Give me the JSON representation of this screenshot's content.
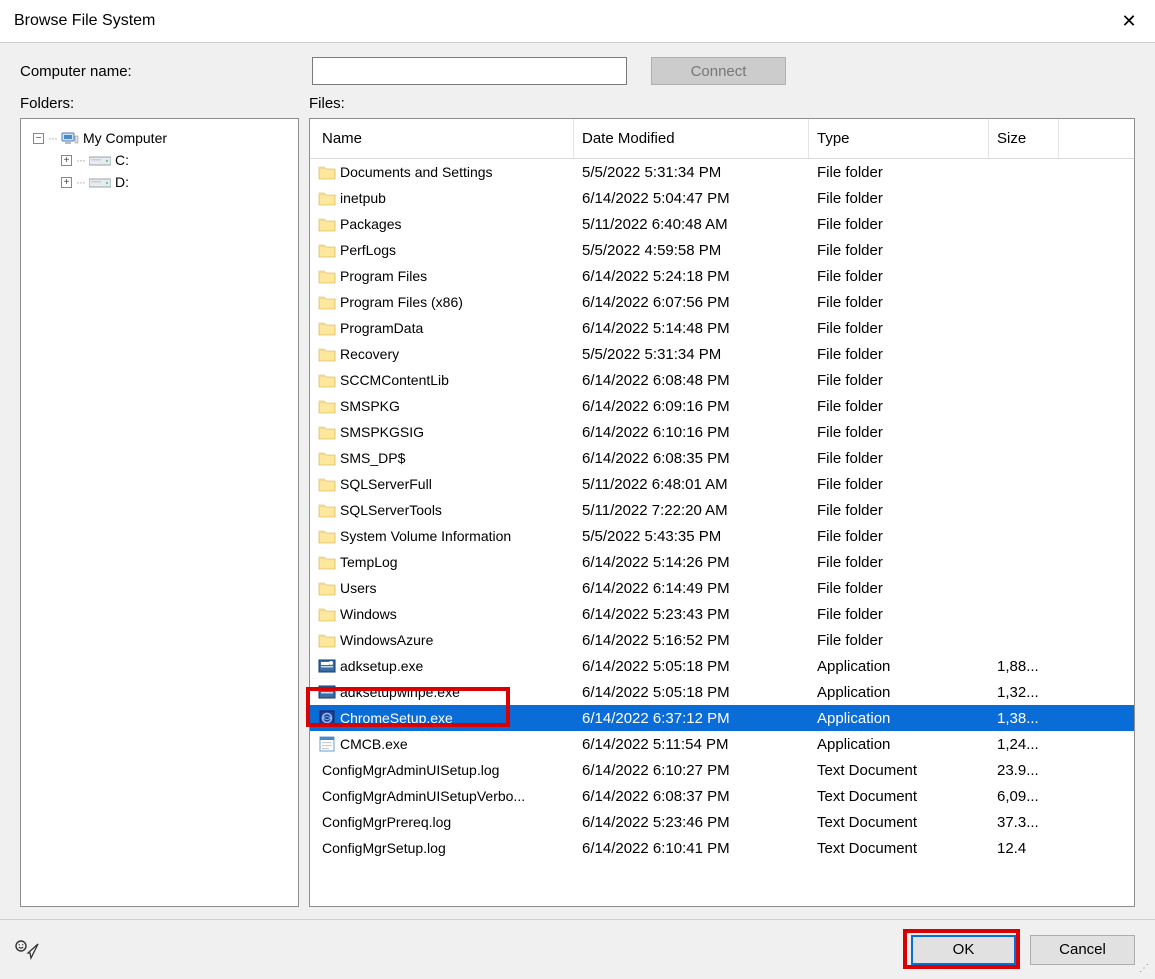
{
  "window": {
    "title": "Browse File System",
    "close_label": "✕"
  },
  "top": {
    "computer_name_label": "Computer name:",
    "computer_name_value": "",
    "connect_label": "Connect"
  },
  "pane_labels": {
    "folders": "Folders:",
    "files": "Files:"
  },
  "tree": {
    "root": {
      "label": "My Computer",
      "expanded": true
    },
    "drives": [
      {
        "label": "C:",
        "expanded": false
      },
      {
        "label": "D:",
        "expanded": false
      }
    ]
  },
  "columns": {
    "name": "Name",
    "date": "Date Modified",
    "type": "Type",
    "size": "Size"
  },
  "files": [
    {
      "name": "Documents and Settings",
      "date": "5/5/2022 5:31:34 PM",
      "type": "File folder",
      "size": "",
      "icon": "folder"
    },
    {
      "name": "inetpub",
      "date": "6/14/2022 5:04:47 PM",
      "type": "File folder",
      "size": "",
      "icon": "folder"
    },
    {
      "name": "Packages",
      "date": "5/11/2022 6:40:48 AM",
      "type": "File folder",
      "size": "",
      "icon": "folder"
    },
    {
      "name": "PerfLogs",
      "date": "5/5/2022 4:59:58 PM",
      "type": "File folder",
      "size": "",
      "icon": "folder"
    },
    {
      "name": "Program Files",
      "date": "6/14/2022 5:24:18 PM",
      "type": "File folder",
      "size": "",
      "icon": "folder"
    },
    {
      "name": "Program Files (x86)",
      "date": "6/14/2022 6:07:56 PM",
      "type": "File folder",
      "size": "",
      "icon": "folder"
    },
    {
      "name": "ProgramData",
      "date": "6/14/2022 5:14:48 PM",
      "type": "File folder",
      "size": "",
      "icon": "folder"
    },
    {
      "name": "Recovery",
      "date": "5/5/2022 5:31:34 PM",
      "type": "File folder",
      "size": "",
      "icon": "folder"
    },
    {
      "name": "SCCMContentLib",
      "date": "6/14/2022 6:08:48 PM",
      "type": "File folder",
      "size": "",
      "icon": "folder"
    },
    {
      "name": "SMSPKG",
      "date": "6/14/2022 6:09:16 PM",
      "type": "File folder",
      "size": "",
      "icon": "folder"
    },
    {
      "name": "SMSPKGSIG",
      "date": "6/14/2022 6:10:16 PM",
      "type": "File folder",
      "size": "",
      "icon": "folder"
    },
    {
      "name": "SMS_DP$",
      "date": "6/14/2022 6:08:35 PM",
      "type": "File folder",
      "size": "",
      "icon": "folder"
    },
    {
      "name": "SQLServerFull",
      "date": "5/11/2022 6:48:01 AM",
      "type": "File folder",
      "size": "",
      "icon": "folder"
    },
    {
      "name": "SQLServerTools",
      "date": "5/11/2022 7:22:20 AM",
      "type": "File folder",
      "size": "",
      "icon": "folder"
    },
    {
      "name": "System Volume Information",
      "date": "5/5/2022 5:43:35 PM",
      "type": "File folder",
      "size": "",
      "icon": "folder"
    },
    {
      "name": "TempLog",
      "date": "6/14/2022 5:14:26 PM",
      "type": "File folder",
      "size": "",
      "icon": "folder"
    },
    {
      "name": "Users",
      "date": "6/14/2022 6:14:49 PM",
      "type": "File folder",
      "size": "",
      "icon": "folder"
    },
    {
      "name": "Windows",
      "date": "6/14/2022 5:23:43 PM",
      "type": "File folder",
      "size": "",
      "icon": "folder"
    },
    {
      "name": "WindowsAzure",
      "date": "6/14/2022 5:16:52 PM",
      "type": "File folder",
      "size": "",
      "icon": "folder"
    },
    {
      "name": "adksetup.exe",
      "date": "6/14/2022 5:05:18 PM",
      "type": "Application",
      "size": "1,88...",
      "icon": "installer"
    },
    {
      "name": "adksetupwinpe.exe",
      "date": "6/14/2022 5:05:18 PM",
      "type": "Application",
      "size": "1,32...",
      "icon": "installer"
    },
    {
      "name": "ChromeSetup.exe",
      "date": "6/14/2022 6:37:12 PM",
      "type": "Application",
      "size": "1,38...",
      "icon": "exe",
      "selected": true
    },
    {
      "name": "CMCB.exe",
      "date": "6/14/2022 5:11:54 PM",
      "type": "Application",
      "size": "1,24...",
      "icon": "app"
    },
    {
      "name": "ConfigMgrAdminUISetup.log",
      "date": "6/14/2022 6:10:27 PM",
      "type": "Text Document",
      "size": "23.9...",
      "icon": "text"
    },
    {
      "name": "ConfigMgrAdminUISetupVerbo...",
      "date": "6/14/2022 6:08:37 PM",
      "type": "Text Document",
      "size": "6,09...",
      "icon": "text"
    },
    {
      "name": "ConfigMgrPrereq.log",
      "date": "6/14/2022 5:23:46 PM",
      "type": "Text Document",
      "size": "37.3...",
      "icon": "text"
    },
    {
      "name": "ConfigMgrSetup.log",
      "date": "6/14/2022 6:10:41 PM",
      "type": "Text Document",
      "size": "12.4",
      "icon": "text"
    }
  ],
  "footer": {
    "ok_label": "OK",
    "cancel_label": "Cancel"
  }
}
